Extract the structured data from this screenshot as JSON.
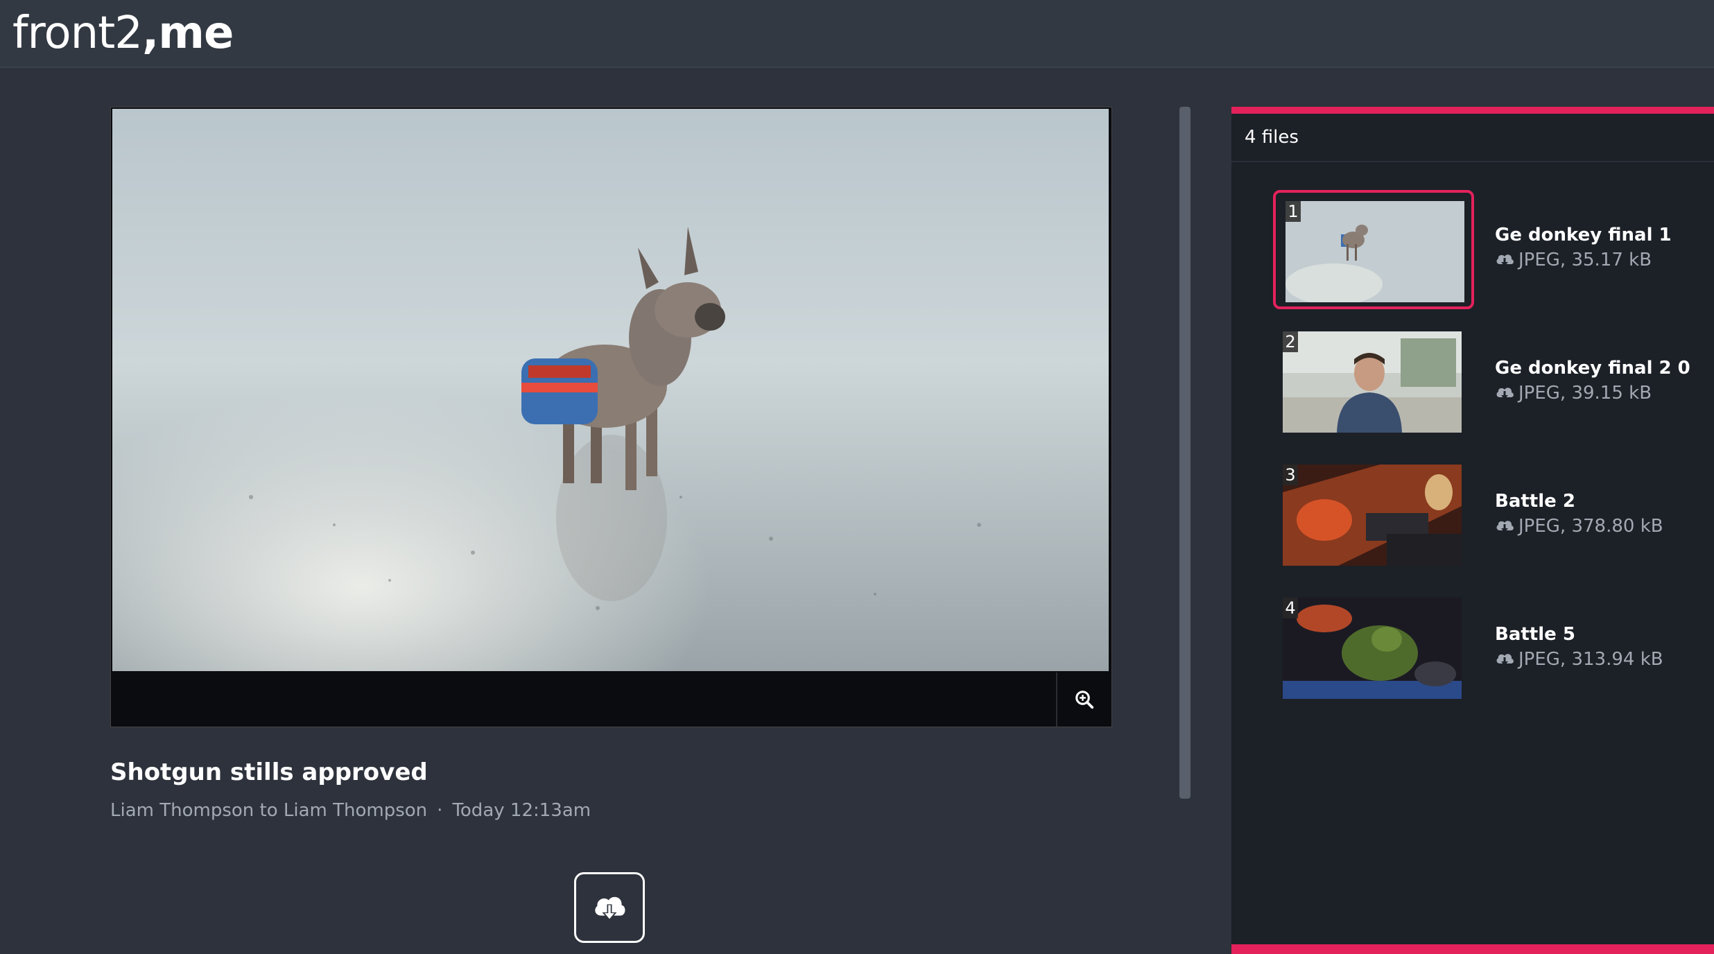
{
  "app": {
    "logo_light": "front2",
    "logo_bold": ",me"
  },
  "viewer": {
    "zoom_icon": "zoom-in-icon"
  },
  "message": {
    "title": "Shotgun stills approved",
    "sender_line": "Liam Thompson to Liam Thompson",
    "separator": "·",
    "time": "Today 12:13am"
  },
  "download": {
    "icon": "cloud-download-icon"
  },
  "files": {
    "count_label": "4 files",
    "items": [
      {
        "index": "1",
        "name": "Ge donkey final 1",
        "meta": "JPEG, 35.17 kB",
        "selected": true
      },
      {
        "index": "2",
        "name": "Ge donkey final 2 0",
        "meta": "JPEG, 39.15 kB",
        "selected": false
      },
      {
        "index": "3",
        "name": "Battle 2",
        "meta": "JPEG, 378.80 kB",
        "selected": false
      },
      {
        "index": "4",
        "name": "Battle 5",
        "meta": "JPEG, 313.94 kB",
        "selected": false
      }
    ]
  },
  "colors": {
    "accent": "#e3225b",
    "background": "#2d323c",
    "panel": "#1c2027"
  }
}
